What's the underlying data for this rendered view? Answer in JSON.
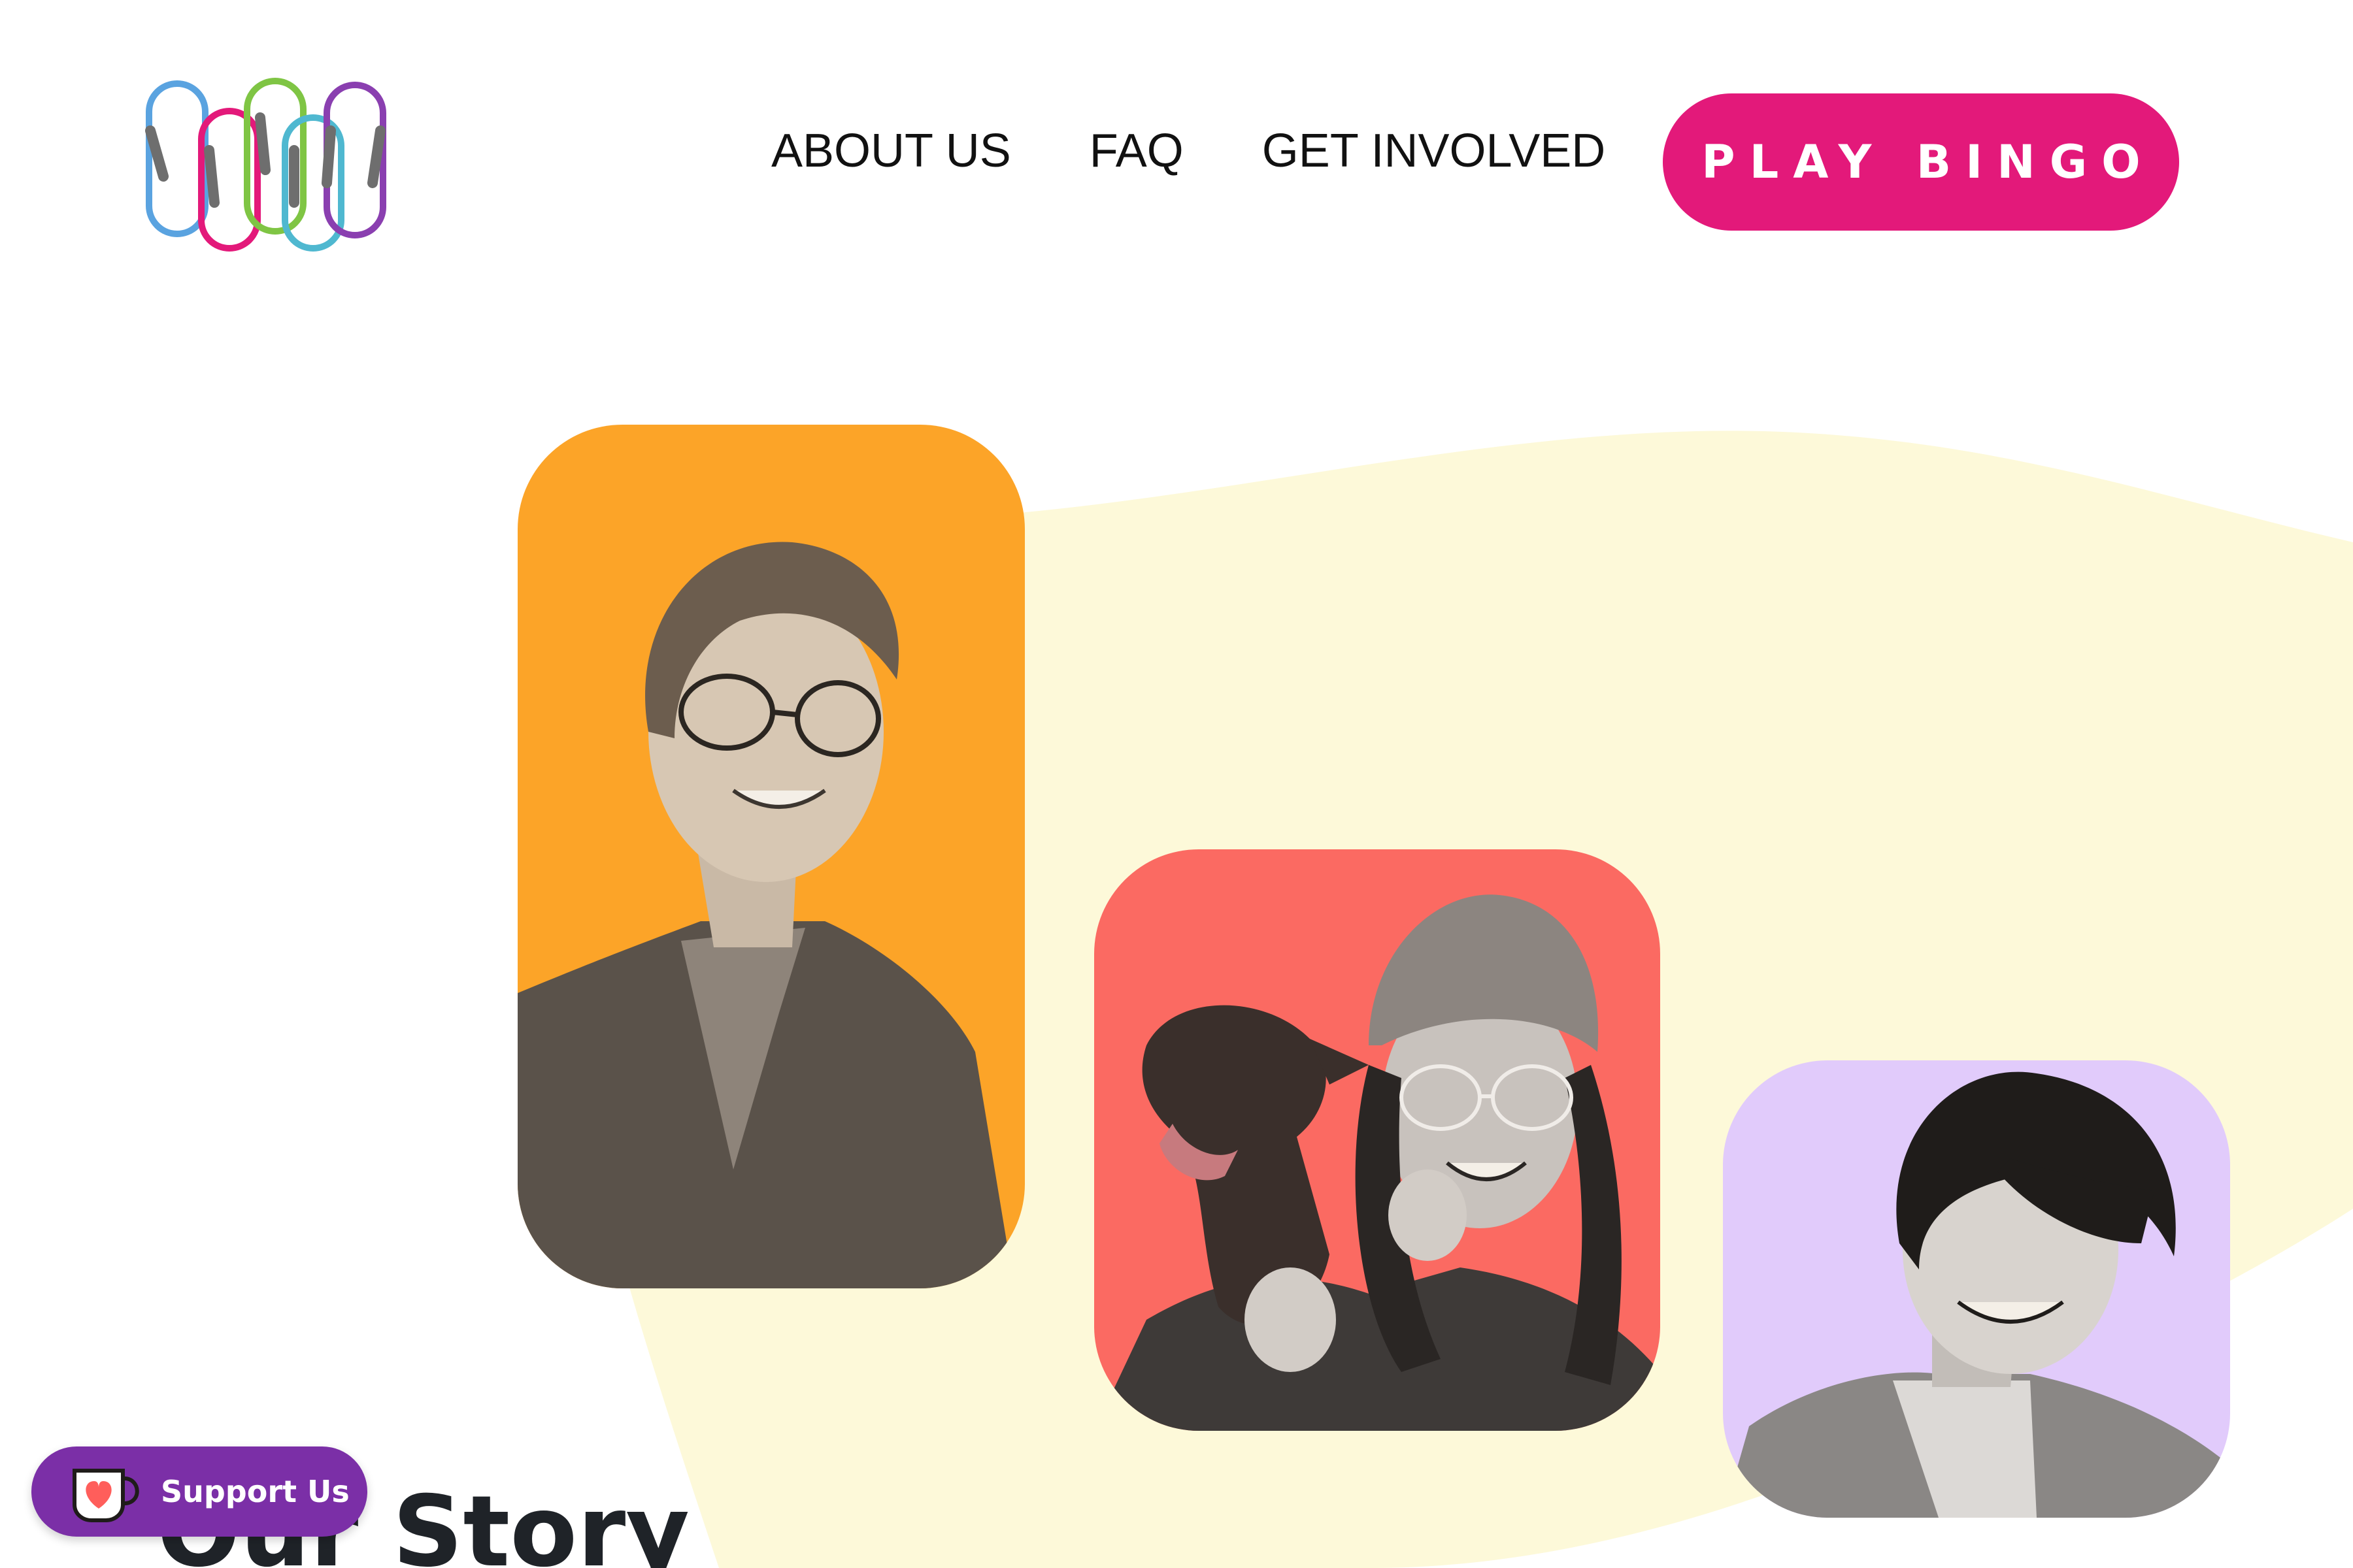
{
  "header": {
    "logo_alt": "carabiner logo",
    "nav": {
      "about": "ABOUT US",
      "faq": "FAQ",
      "get_involved": "GET INVOLVED"
    },
    "cta_label": "PLAY BINGO"
  },
  "hero": {
    "photos": [
      {
        "name": "team-photo-person-1",
        "bg_color": "#fca428"
      },
      {
        "name": "team-photo-person-2-with-dog",
        "bg_color": "#fb6a62"
      },
      {
        "name": "team-photo-person-3",
        "bg_color": "#e1cbfb"
      }
    ],
    "blob_color": "#fdf9d9"
  },
  "section": {
    "title": "Our Story"
  },
  "support_widget": {
    "label": "Support Us",
    "icon": "ko-fi-cup-heart-icon",
    "color": "#7b2fa7"
  },
  "colors": {
    "accent": "#e3197a",
    "text": "#111111"
  }
}
